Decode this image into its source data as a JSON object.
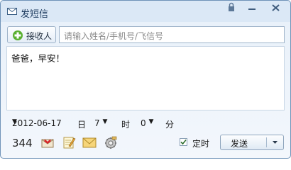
{
  "window": {
    "title": "发短信"
  },
  "recipient": {
    "button_label": "接收人",
    "placeholder": "请输入姓名/手机号/飞信号"
  },
  "message": {
    "text": "爸爸，早安！"
  },
  "schedule": {
    "date": "2012-06-17",
    "day_label": "日",
    "hour": "7",
    "hour_label": "时",
    "minute": "0",
    "minute_label": "分"
  },
  "footer": {
    "char_count": "344",
    "timer_label": "定时",
    "send_label": "发送"
  },
  "colors": {
    "title_bar": "#dbe8f6",
    "border": "#6f93b8"
  }
}
